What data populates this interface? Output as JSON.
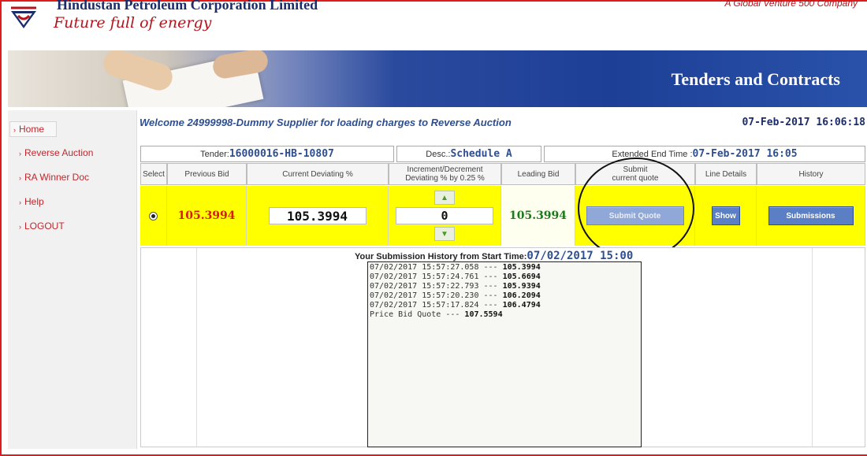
{
  "header": {
    "company_name": "Hindustan Petroleum Corporation Limited",
    "tagline": "Future full of energy",
    "top_right": "A Global Venture 500 Company",
    "banner_title": "Tenders and Contracts"
  },
  "sidebar": {
    "items": [
      {
        "label": "Home"
      },
      {
        "label": "Reverse Auction"
      },
      {
        "label": "RA Winner Doc"
      },
      {
        "label": "Help"
      },
      {
        "label": "LOGOUT"
      }
    ]
  },
  "welcome": {
    "text": "Welcome 24999998-Dummy Supplier for loading charges to Reverse Auction",
    "datetime": "07-Feb-2017  16:06:18"
  },
  "tender": {
    "tender_label": "Tender:",
    "tender_value": "16000016-HB-10807",
    "desc_label": "Desc.:",
    "desc_value": "Schedule A",
    "end_label": "Extended End Time :",
    "end_value": "07-Feb-2017 16:05"
  },
  "grid": {
    "headers": {
      "select": "Select",
      "previous_bid": "Previous Bid",
      "current_deviating": "Current Deviating %",
      "increment_line1": "Increment/Decrement",
      "increment_line2": "Deviating % by 0.25 %",
      "leading_bid": "Leading Bid",
      "submit_line1": "Submit",
      "submit_line2": "current quote",
      "line_details": "Line Details",
      "history": "History"
    },
    "row": {
      "previous_bid": "105.3994",
      "current_deviating": "105.3994",
      "increment_value": "0",
      "leading_bid": "105.3994",
      "submit_button": "Submit Quote",
      "show_button": "Show",
      "submissions_button": "Submissions"
    }
  },
  "history": {
    "title": "Your Submission History from Start Time:",
    "start_time": "07/02/2017 15:00",
    "entries": [
      {
        "time": "07/02/2017 15:57:27.058 ---",
        "value": "105.3994"
      },
      {
        "time": "07/02/2017 15:57:24.761 ---",
        "value": "105.6694"
      },
      {
        "time": "07/02/2017 15:57:22.793 ---",
        "value": "105.9394"
      },
      {
        "time": "07/02/2017 15:57:20.230 ---",
        "value": "106.2094"
      },
      {
        "time": "07/02/2017 15:57:17.824 ---",
        "value": "106.4794"
      }
    ],
    "price_label": "Price Bid Quote ---",
    "price_value": "107.5594"
  },
  "colors": {
    "accent_blue": "#2d4f92",
    "previous_bid_red": "#d61c1c",
    "leading_bid_green": "#1c7a1c",
    "row_highlight": "#ffff00",
    "frame_red": "#e01b1b"
  }
}
